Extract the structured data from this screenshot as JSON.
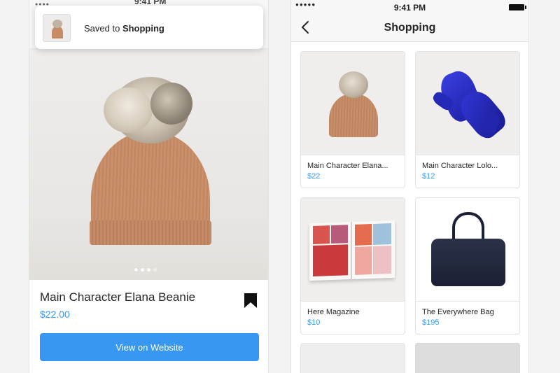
{
  "left": {
    "status_time": "9:41 PM",
    "toast": {
      "prefix": "Saved to ",
      "collection": "Shopping"
    },
    "product": {
      "title": "Main Character Elana Beanie",
      "price": "$22.00"
    },
    "cta_label": "View on Website",
    "pager": {
      "total": 4,
      "active": 1
    }
  },
  "right": {
    "status_time": "9:41 PM",
    "title": "Shopping",
    "items": [
      {
        "name": "Main Character Elana...",
        "price": "$22"
      },
      {
        "name": "Main Character Lolo...",
        "price": "$12"
      },
      {
        "name": "Here Magazine",
        "price": "$10"
      },
      {
        "name": "The Everywhere Bag",
        "price": "$195"
      }
    ]
  },
  "colors": {
    "accent_blue": "#3897f0",
    "text": "#262626"
  },
  "icons": [
    "bookmark-icon",
    "back-chevron-icon",
    "signal-dots-icon",
    "battery-icon"
  ]
}
